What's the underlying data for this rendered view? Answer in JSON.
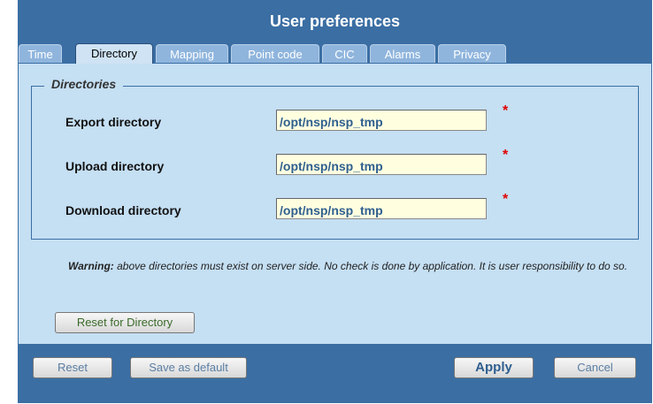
{
  "dialog": {
    "title": "User preferences"
  },
  "tabs": [
    {
      "label": "Time"
    },
    {
      "label": "Directory"
    },
    {
      "label": "Mapping"
    },
    {
      "label": "Point code"
    },
    {
      "label": "CIC"
    },
    {
      "label": "Alarms"
    },
    {
      "label": "Privacy"
    }
  ],
  "active_tab": "Directory",
  "directories": {
    "legend": "Directories",
    "rows": [
      {
        "label": "Export directory",
        "value": "/opt/nsp/nsp_tmp",
        "required_mark": "*"
      },
      {
        "label": "Upload directory",
        "value": "/opt/nsp/nsp_tmp",
        "required_mark": "*"
      },
      {
        "label": "Download directory",
        "value": "/opt/nsp/nsp_tmp",
        "required_mark": "*"
      }
    ]
  },
  "warning": {
    "prefix": "Warning:",
    "text": " above directories must exist on server side. No check is done by application. It is user responsibility to do so."
  },
  "reset_directory_label": "Reset for Directory",
  "footer": {
    "reset_label": "Reset",
    "save_default_label": "Save as default",
    "apply_label": "Apply",
    "cancel_label": "Cancel"
  },
  "colors": {
    "dialog_background": "#3b6ea3",
    "panel_background": "#c5dff3",
    "input_background": "#ffffe0",
    "required_marker": "#e00000"
  }
}
